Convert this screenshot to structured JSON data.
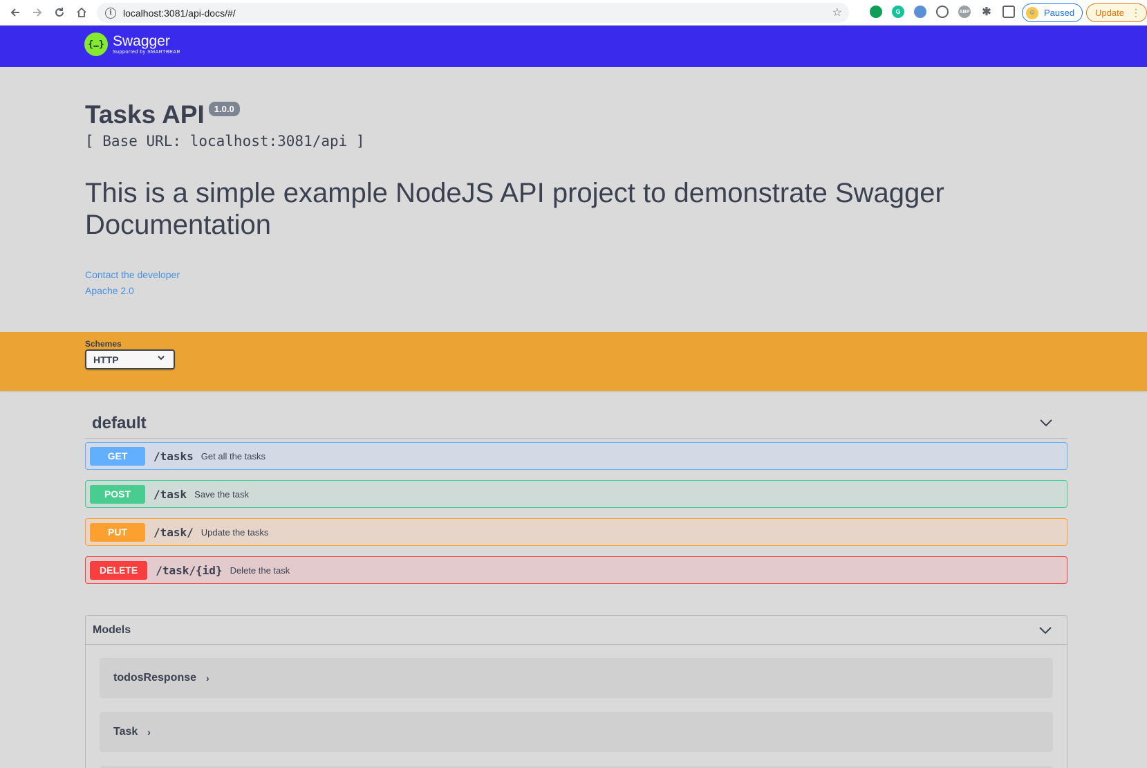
{
  "browser": {
    "url": "localhost:3081/api-docs/#/",
    "paused_label": "Paused",
    "update_label": "Update"
  },
  "swagger": {
    "brand": "Swagger",
    "brand_sub": "Supported by SMARTBEAR"
  },
  "info": {
    "title": "Tasks API",
    "version": "1.0.0",
    "base_url": "[ Base URL: localhost:3081/api ]",
    "description": "This is a simple example NodeJS API project to demonstrate Swagger Documentation",
    "contact_link": "Contact the developer",
    "license_link": "Apache 2.0"
  },
  "schemes": {
    "label": "Schemes",
    "selected": "HTTP"
  },
  "tag": {
    "name": "default"
  },
  "operations": [
    {
      "method": "GET",
      "path": "/tasks",
      "summary": "Get all the tasks",
      "color": "#61affe",
      "bg": "#d3dae5",
      "border": "#61affe"
    },
    {
      "method": "POST",
      "path": "/task",
      "summary": "Save the task",
      "color": "#49cc90",
      "bg": "#cfdbd6",
      "border": "#49cc90"
    },
    {
      "method": "PUT",
      "path": "/task/",
      "summary": "Update the tasks",
      "color": "#fca130",
      "bg": "#e6d5c8",
      "border": "#fca130"
    },
    {
      "method": "DELETE",
      "path": "/task/{id}",
      "summary": "Delete the task",
      "color": "#f93e3e",
      "bg": "#e3cacc",
      "border": "#f93e3e"
    }
  ],
  "models": {
    "label": "Models",
    "items": [
      "todosResponse",
      "Task"
    ]
  },
  "icons": {
    "back": "arrow-left-icon",
    "forward": "arrow-right-icon",
    "reload": "reload-icon",
    "home": "home-icon",
    "info": "info-icon",
    "star": "star-icon",
    "chevron": "chevron-down-icon"
  }
}
